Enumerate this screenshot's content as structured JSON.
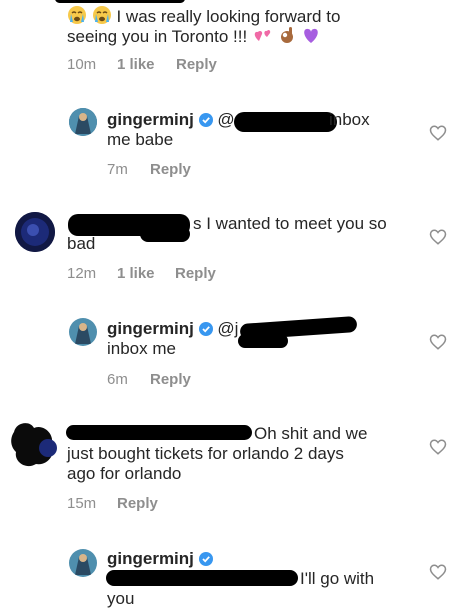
{
  "comments": [
    {
      "text_a": "I was really looking forward to",
      "text_b": "seeing you in Toronto !!!",
      "time": "10m",
      "likes": "1 like",
      "reply": "Reply"
    },
    {
      "username": "gingerminj",
      "mention_prefix": "@",
      "text_a": "inbox",
      "text_b": "me babe",
      "time": "7m",
      "reply": "Reply"
    },
    {
      "text_a": "s I wanted to meet you so",
      "text_b": "bad",
      "time": "12m",
      "likes": "1 like",
      "reply": "Reply"
    },
    {
      "username": "gingerminj",
      "mention_prefix": "@j",
      "text_b": "inbox me",
      "time": "6m",
      "reply": "Reply"
    },
    {
      "text_a": "Oh shit and we",
      "text_b": "just bought tickets for orlando 2 days",
      "text_c": "ago for orlando",
      "time": "15m",
      "reply": "Reply"
    },
    {
      "username": "gingerminj",
      "text_a": "I'll go with",
      "text_b": "you"
    }
  ],
  "colors": {
    "verified": "#3897f0",
    "meta": "#8e8e8e",
    "text": "#262626",
    "heart": "#8e8e8e"
  },
  "icons": {
    "heart": "heart-outline-icon",
    "verified": "verified-badge-icon"
  }
}
